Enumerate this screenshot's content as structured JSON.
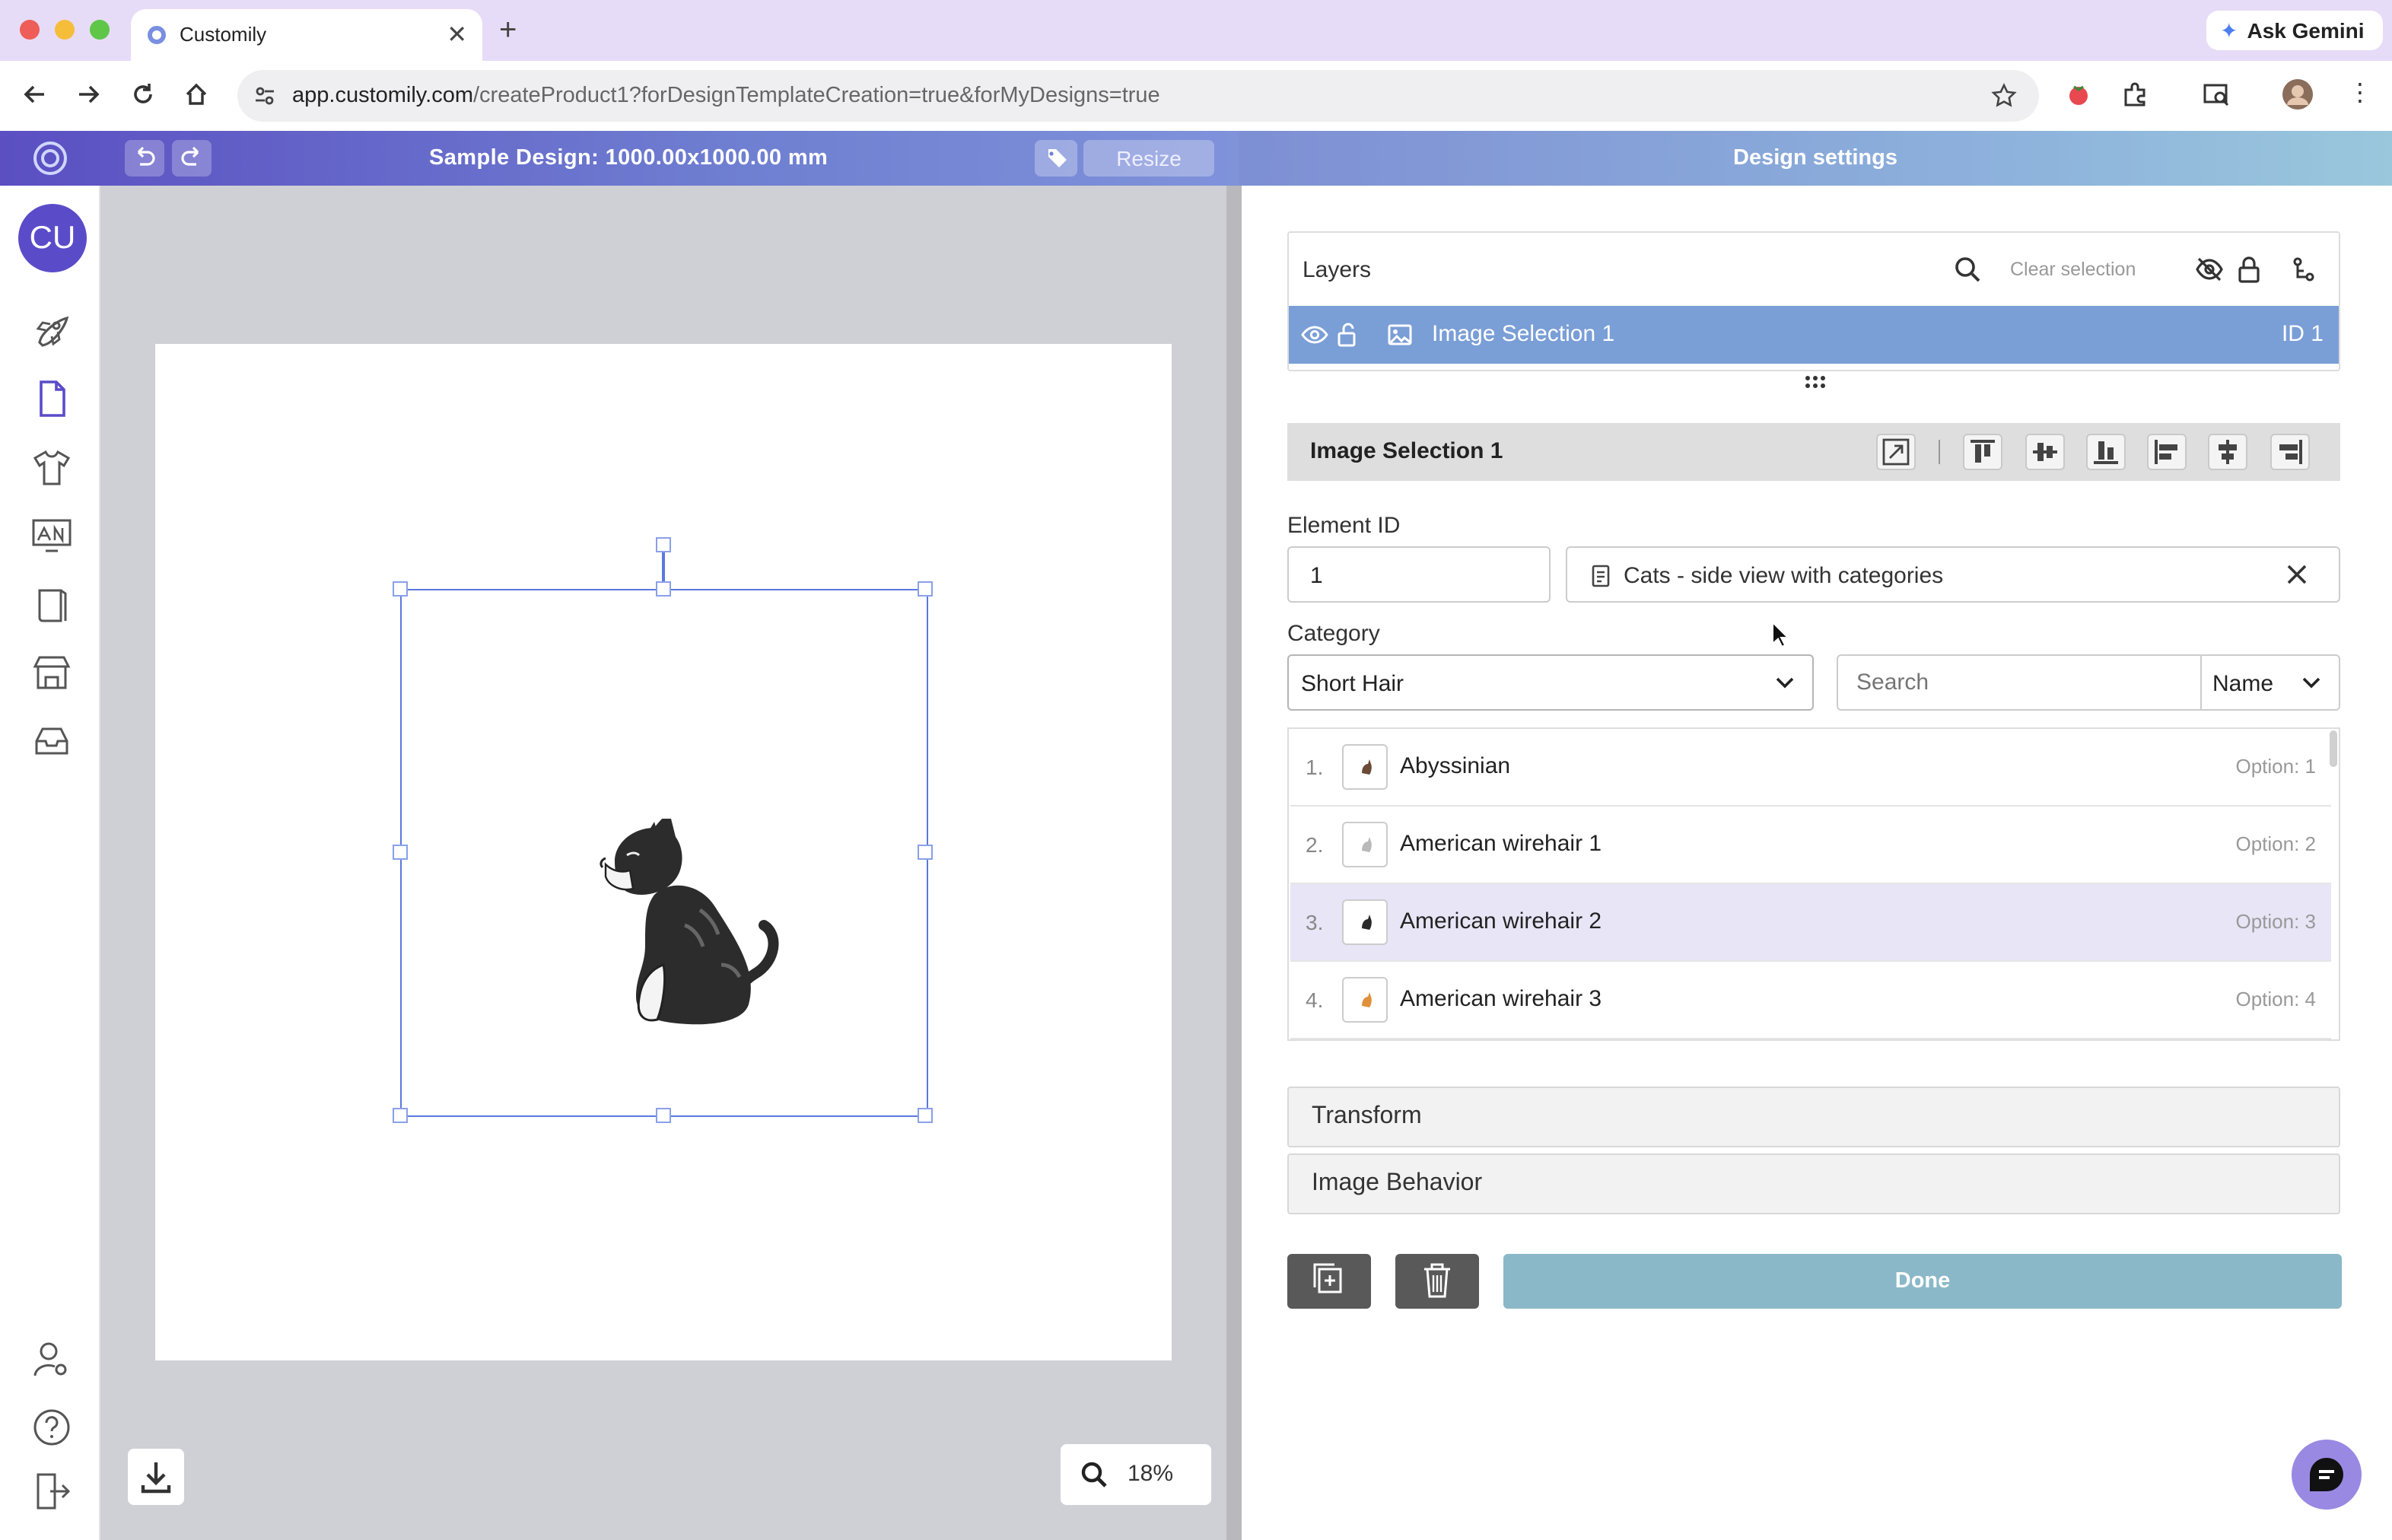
{
  "browser": {
    "tab_title": "Customily",
    "url_host": "app.customily.com",
    "url_path": "/createProduct1?forDesignTemplateCreation=true&forMyDesigns=true",
    "ask_gemini": "Ask Gemini"
  },
  "header": {
    "design_title": "Sample Design: 1000.00x1000.00 mm",
    "resize_label": "Resize",
    "settings_title": "Design settings"
  },
  "sidebar": {
    "avatar_initials": "CU",
    "items": [
      "rocket-icon",
      "document-icon",
      "tshirt-icon",
      "artwork-icon",
      "book-icon",
      "store-icon",
      "inbox-icon"
    ],
    "bottom_items": [
      "user-settings-icon",
      "help-icon",
      "logout-icon"
    ]
  },
  "canvas": {
    "zoom": "18%"
  },
  "layers": {
    "title": "Layers",
    "clear_selection": "Clear selection",
    "items": [
      {
        "name": "Image Selection 1",
        "id": "ID 1"
      }
    ]
  },
  "element": {
    "title": "Image Selection 1",
    "element_id_label": "Element ID",
    "element_id_value": "1",
    "library_name": "Cats - side view with categories",
    "category_label": "Category",
    "category_value": "Short Hair",
    "search_placeholder": "Search",
    "sort_value": "Name",
    "options": [
      {
        "num": "1.",
        "name": "Abyssinian",
        "option": "Option: 1"
      },
      {
        "num": "2.",
        "name": "American wirehair 1",
        "option": "Option: 2"
      },
      {
        "num": "3.",
        "name": "American wirehair 2",
        "option": "Option: 3"
      },
      {
        "num": "4.",
        "name": "American wirehair 3",
        "option": "Option: 4"
      }
    ],
    "transform_label": "Transform",
    "image_behavior_label": "Image Behavior",
    "done_label": "Done"
  },
  "colors": {
    "brand": "#5a4cc9",
    "layer_selected": "#7a9ed6",
    "done_button": "#8ab8c8",
    "highlight_row": "#e8e5f7"
  }
}
